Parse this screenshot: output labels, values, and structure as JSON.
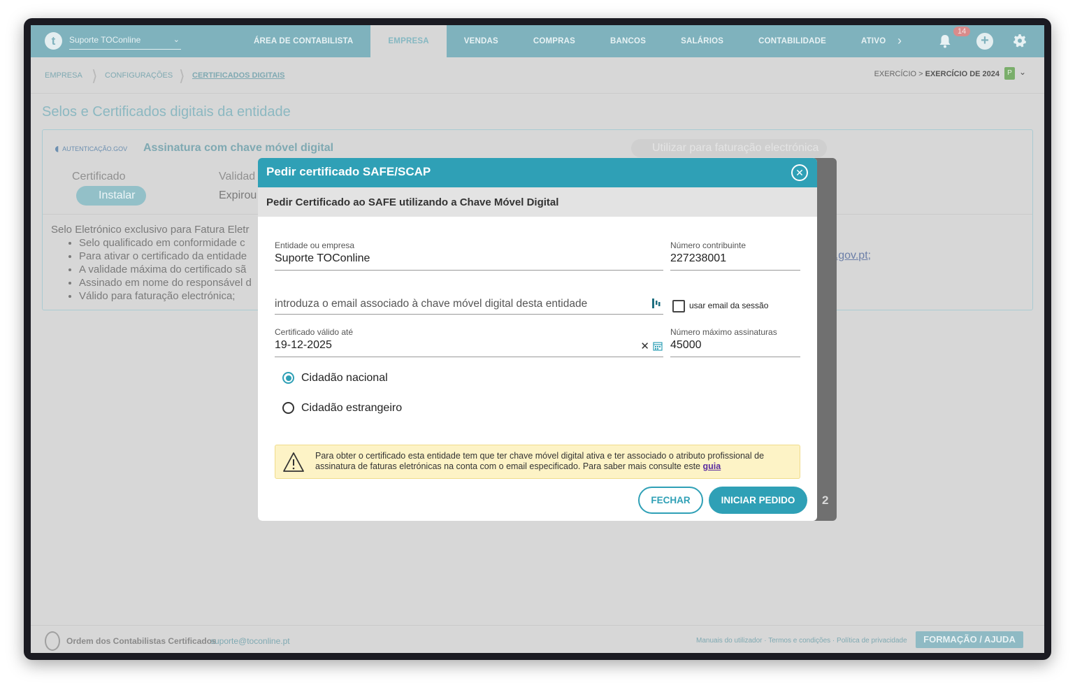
{
  "topbar": {
    "logo": "t",
    "company": "Suporte TOConline",
    "nav": [
      "ÁREA DE CONTABILISTA",
      "EMPRESA",
      "VENDAS",
      "COMPRAS",
      "BANCOS",
      "SALÁRIOS",
      "CONTABILIDADE",
      "ATIVO"
    ],
    "active_nav": "EMPRESA",
    "notifications_count": "14"
  },
  "breadcrumb": {
    "items": [
      "EMPRESA",
      "CONFIGURAÇÕES",
      "CERTIFICADOS DIGITAIS"
    ],
    "exercise_prefix": "EXERCÍCIO >",
    "exercise_value": "EXERCÍCIO DE 2024",
    "exercise_badge": "P"
  },
  "page": {
    "title": "Selos e Certificados digitais da entidade",
    "card": {
      "provider_logo": "AUTENTICAÇÃO.GOV",
      "title": "Assinatura com chave móvel digital",
      "invoice_button": "Utilizar para faturação electrónica",
      "cert_label": "Certificado",
      "valid_label": "Validad",
      "install_button": "Instalar",
      "valid_value": "Expirou",
      "desc_intro": "Selo Eletrónico exclusivo para Fatura Eletr",
      "desc_items": [
        "Selo qualificado em conformidade c",
        "Para ativar o certificado da entidade",
        "A validade máxima do certificado sã",
        "Assinado em nome do responsável d",
        "Válido para faturação electrónica;"
      ],
      "link_fragment": "cao.gov.pt",
      "link_suffix": ";"
    }
  },
  "dialog": {
    "title": "Pedir certificado SAFE/SCAP",
    "subtitle": "Pedir Certificado ao SAFE utilizando a Chave Móvel Digital",
    "entity_label": "Entidade ou empresa",
    "entity_value": "Suporte TOConline",
    "nif_label": "Número contribuinte",
    "nif_value": "227238001",
    "email_placeholder": "introduza o email associado à chave móvel digital desta entidade",
    "use_session_email": "usar email da sessão",
    "valid_until_label": "Certificado válido até",
    "valid_until_value": "19-12-2025",
    "max_signatures_label": "Número máximo assinaturas",
    "max_signatures_value": "45000",
    "radio_national": "Cidadão nacional",
    "radio_foreign": "Cidadão estrangeiro",
    "selected_radio": "national",
    "warning_text": "Para obter o certificado esta entidade tem que ter chave móvel digital ativa e ter associado o atributo profissional de assinatura de faturas eletrónicas na conta com o email especificado. Para saber mais consulte este",
    "warning_link": "guia",
    "close_button": "FECHAR",
    "start_button": "INICIAR PEDIDO",
    "stacked_dialog_number": "2"
  },
  "footer": {
    "org": "Ordem dos Contabilistas Certificados",
    "email": "suporte@toconline.pt",
    "links": "Manuais do utilizador · Termos e condições · Política de privacidade",
    "help_button": "FORMAÇÃO / AJUDA"
  },
  "colors": {
    "primary": "#2fa0b6",
    "topbar": "#7fb2bd",
    "warning_bg": "#fdf3c6"
  }
}
